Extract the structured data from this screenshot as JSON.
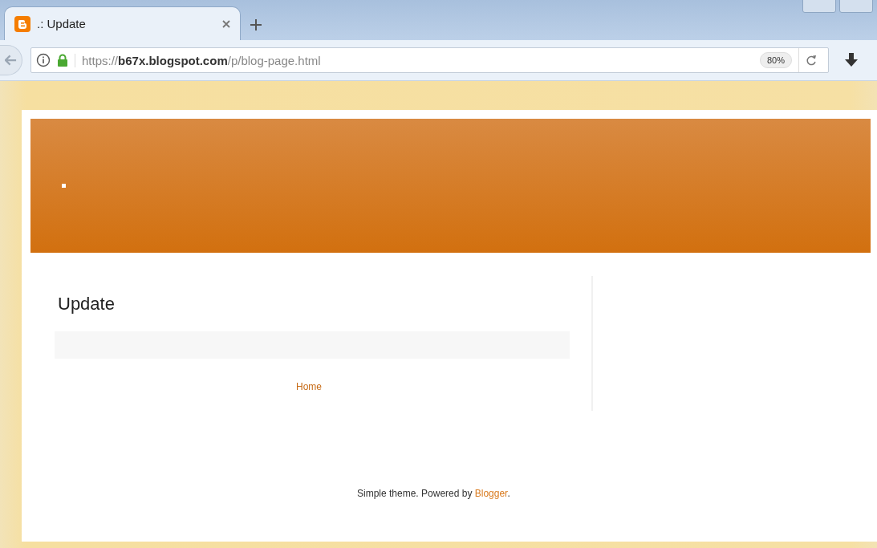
{
  "tabs": [
    {
      "title": ".: Update",
      "selected": true
    }
  ],
  "toolbar": {
    "url": {
      "scheme": "https://",
      "host": "b67x.blogspot.com",
      "path": "/p/blog-page.html"
    },
    "zoom": "80%"
  },
  "blog": {
    "post_title": "Update",
    "home_link": "Home",
    "footer": {
      "prefix": "Simple theme. Powered by ",
      "link": "Blogger",
      "suffix": "."
    }
  }
}
